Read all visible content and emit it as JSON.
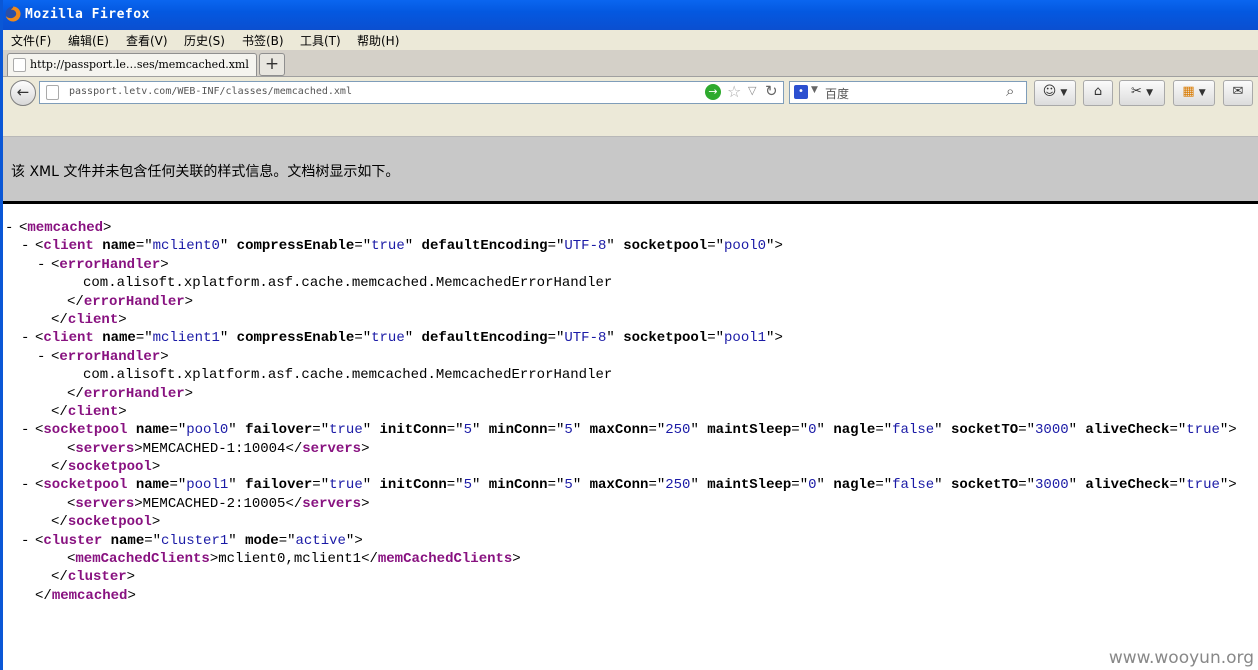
{
  "window": {
    "title": "Mozilla Firefox"
  },
  "menu": [
    "文件(F)",
    "编辑(E)",
    "查看(V)",
    "历史(S)",
    "书签(B)",
    "工具(T)",
    "帮助(H)"
  ],
  "tab": {
    "label": "http://passport.le…ses/memcached.xml",
    "new_tab": "+"
  },
  "nav": {
    "url": "passport.letv.com/WEB-INF/classes/memcached.xml",
    "search_placeholder": "百度"
  },
  "banner": "该 XML 文件并未包含任何关联的样式信息。文档树显示如下。",
  "xml": [
    {
      "ctl": "-",
      "indent": 0,
      "parts": [
        {
          "t": "b",
          "v": "<"
        },
        {
          "t": "tag",
          "v": "memcached"
        },
        {
          "t": "b",
          "v": ">"
        }
      ]
    },
    {
      "ctl": "-",
      "indent": 1,
      "parts": [
        {
          "t": "b",
          "v": "<"
        },
        {
          "t": "tag",
          "v": "client"
        },
        {
          "t": "an",
          "v": " name"
        },
        {
          "t": "b",
          "v": "=\""
        },
        {
          "t": "av",
          "v": "mclient0"
        },
        {
          "t": "b",
          "v": "\""
        },
        {
          "t": "an",
          "v": " compressEnable"
        },
        {
          "t": "b",
          "v": "=\""
        },
        {
          "t": "av",
          "v": "true"
        },
        {
          "t": "b",
          "v": "\""
        },
        {
          "t": "an",
          "v": " defaultEncoding"
        },
        {
          "t": "b",
          "v": "=\""
        },
        {
          "t": "av",
          "v": "UTF-8"
        },
        {
          "t": "b",
          "v": "\""
        },
        {
          "t": "an",
          "v": " socketpool"
        },
        {
          "t": "b",
          "v": "=\""
        },
        {
          "t": "av",
          "v": "pool0"
        },
        {
          "t": "b",
          "v": "\">"
        }
      ]
    },
    {
      "ctl": "-",
      "indent": 2,
      "parts": [
        {
          "t": "b",
          "v": "<"
        },
        {
          "t": "tag",
          "v": "errorHandler"
        },
        {
          "t": "b",
          "v": ">"
        }
      ]
    },
    {
      "ctl": "",
      "indent": 4,
      "parts": [
        {
          "t": "tx",
          "v": "com.alisoft.xplatform.asf.cache.memcached.MemcachedErrorHandler"
        }
      ]
    },
    {
      "ctl": "",
      "indent": 3,
      "parts": [
        {
          "t": "b",
          "v": "</"
        },
        {
          "t": "tag",
          "v": "errorHandler"
        },
        {
          "t": "b",
          "v": ">"
        }
      ]
    },
    {
      "ctl": "",
      "indent": 2,
      "parts": [
        {
          "t": "b",
          "v": "</"
        },
        {
          "t": "tag",
          "v": "client"
        },
        {
          "t": "b",
          "v": ">"
        }
      ]
    },
    {
      "ctl": "-",
      "indent": 1,
      "parts": [
        {
          "t": "b",
          "v": "<"
        },
        {
          "t": "tag",
          "v": "client"
        },
        {
          "t": "an",
          "v": " name"
        },
        {
          "t": "b",
          "v": "=\""
        },
        {
          "t": "av",
          "v": "mclient1"
        },
        {
          "t": "b",
          "v": "\""
        },
        {
          "t": "an",
          "v": " compressEnable"
        },
        {
          "t": "b",
          "v": "=\""
        },
        {
          "t": "av",
          "v": "true"
        },
        {
          "t": "b",
          "v": "\""
        },
        {
          "t": "an",
          "v": " defaultEncoding"
        },
        {
          "t": "b",
          "v": "=\""
        },
        {
          "t": "av",
          "v": "UTF-8"
        },
        {
          "t": "b",
          "v": "\""
        },
        {
          "t": "an",
          "v": " socketpool"
        },
        {
          "t": "b",
          "v": "=\""
        },
        {
          "t": "av",
          "v": "pool1"
        },
        {
          "t": "b",
          "v": "\">"
        }
      ]
    },
    {
      "ctl": "-",
      "indent": 2,
      "parts": [
        {
          "t": "b",
          "v": "<"
        },
        {
          "t": "tag",
          "v": "errorHandler"
        },
        {
          "t": "b",
          "v": ">"
        }
      ]
    },
    {
      "ctl": "",
      "indent": 4,
      "parts": [
        {
          "t": "tx",
          "v": "com.alisoft.xplatform.asf.cache.memcached.MemcachedErrorHandler"
        }
      ]
    },
    {
      "ctl": "",
      "indent": 3,
      "parts": [
        {
          "t": "b",
          "v": "</"
        },
        {
          "t": "tag",
          "v": "errorHandler"
        },
        {
          "t": "b",
          "v": ">"
        }
      ]
    },
    {
      "ctl": "",
      "indent": 2,
      "parts": [
        {
          "t": "b",
          "v": "</"
        },
        {
          "t": "tag",
          "v": "client"
        },
        {
          "t": "b",
          "v": ">"
        }
      ]
    },
    {
      "ctl": "-",
      "indent": 1,
      "parts": [
        {
          "t": "b",
          "v": "<"
        },
        {
          "t": "tag",
          "v": "socketpool"
        },
        {
          "t": "an",
          "v": " name"
        },
        {
          "t": "b",
          "v": "=\""
        },
        {
          "t": "av",
          "v": "pool0"
        },
        {
          "t": "b",
          "v": "\""
        },
        {
          "t": "an",
          "v": " failover"
        },
        {
          "t": "b",
          "v": "=\""
        },
        {
          "t": "av",
          "v": "true"
        },
        {
          "t": "b",
          "v": "\""
        },
        {
          "t": "an",
          "v": " initConn"
        },
        {
          "t": "b",
          "v": "=\""
        },
        {
          "t": "av",
          "v": "5"
        },
        {
          "t": "b",
          "v": "\""
        },
        {
          "t": "an",
          "v": " minConn"
        },
        {
          "t": "b",
          "v": "=\""
        },
        {
          "t": "av",
          "v": "5"
        },
        {
          "t": "b",
          "v": "\""
        },
        {
          "t": "an",
          "v": " maxConn"
        },
        {
          "t": "b",
          "v": "=\""
        },
        {
          "t": "av",
          "v": "250"
        },
        {
          "t": "b",
          "v": "\""
        },
        {
          "t": "an",
          "v": " maintSleep"
        },
        {
          "t": "b",
          "v": "=\""
        },
        {
          "t": "av",
          "v": "0"
        },
        {
          "t": "b",
          "v": "\""
        },
        {
          "t": "an",
          "v": " nagle"
        },
        {
          "t": "b",
          "v": "=\""
        },
        {
          "t": "av",
          "v": "false"
        },
        {
          "t": "b",
          "v": "\""
        },
        {
          "t": "an",
          "v": " socketTO"
        },
        {
          "t": "b",
          "v": "=\""
        },
        {
          "t": "av",
          "v": "3000"
        },
        {
          "t": "b",
          "v": "\""
        },
        {
          "t": "an",
          "v": " aliveCheck"
        },
        {
          "t": "b",
          "v": "=\""
        },
        {
          "t": "av",
          "v": "true"
        },
        {
          "t": "b",
          "v": "\">"
        }
      ]
    },
    {
      "ctl": "",
      "indent": 3,
      "parts": [
        {
          "t": "b",
          "v": "<"
        },
        {
          "t": "tag",
          "v": "servers"
        },
        {
          "t": "b",
          "v": ">"
        },
        {
          "t": "tx",
          "v": "MEMCACHED-1:10004"
        },
        {
          "t": "b",
          "v": "</"
        },
        {
          "t": "tag",
          "v": "servers"
        },
        {
          "t": "b",
          "v": ">"
        }
      ]
    },
    {
      "ctl": "",
      "indent": 2,
      "parts": [
        {
          "t": "b",
          "v": "</"
        },
        {
          "t": "tag",
          "v": "socketpool"
        },
        {
          "t": "b",
          "v": ">"
        }
      ]
    },
    {
      "ctl": "-",
      "indent": 1,
      "parts": [
        {
          "t": "b",
          "v": "<"
        },
        {
          "t": "tag",
          "v": "socketpool"
        },
        {
          "t": "an",
          "v": " name"
        },
        {
          "t": "b",
          "v": "=\""
        },
        {
          "t": "av",
          "v": "pool1"
        },
        {
          "t": "b",
          "v": "\""
        },
        {
          "t": "an",
          "v": " failover"
        },
        {
          "t": "b",
          "v": "=\""
        },
        {
          "t": "av",
          "v": "true"
        },
        {
          "t": "b",
          "v": "\""
        },
        {
          "t": "an",
          "v": " initConn"
        },
        {
          "t": "b",
          "v": "=\""
        },
        {
          "t": "av",
          "v": "5"
        },
        {
          "t": "b",
          "v": "\""
        },
        {
          "t": "an",
          "v": " minConn"
        },
        {
          "t": "b",
          "v": "=\""
        },
        {
          "t": "av",
          "v": "5"
        },
        {
          "t": "b",
          "v": "\""
        },
        {
          "t": "an",
          "v": " maxConn"
        },
        {
          "t": "b",
          "v": "=\""
        },
        {
          "t": "av",
          "v": "250"
        },
        {
          "t": "b",
          "v": "\""
        },
        {
          "t": "an",
          "v": " maintSleep"
        },
        {
          "t": "b",
          "v": "=\""
        },
        {
          "t": "av",
          "v": "0"
        },
        {
          "t": "b",
          "v": "\""
        },
        {
          "t": "an",
          "v": " nagle"
        },
        {
          "t": "b",
          "v": "=\""
        },
        {
          "t": "av",
          "v": "false"
        },
        {
          "t": "b",
          "v": "\""
        },
        {
          "t": "an",
          "v": " socketTO"
        },
        {
          "t": "b",
          "v": "=\""
        },
        {
          "t": "av",
          "v": "3000"
        },
        {
          "t": "b",
          "v": "\""
        },
        {
          "t": "an",
          "v": " aliveCheck"
        },
        {
          "t": "b",
          "v": "=\""
        },
        {
          "t": "av",
          "v": "true"
        },
        {
          "t": "b",
          "v": "\">"
        }
      ]
    },
    {
      "ctl": "",
      "indent": 3,
      "parts": [
        {
          "t": "b",
          "v": "<"
        },
        {
          "t": "tag",
          "v": "servers"
        },
        {
          "t": "b",
          "v": ">"
        },
        {
          "t": "tx",
          "v": "MEMCACHED-2:10005"
        },
        {
          "t": "b",
          "v": "</"
        },
        {
          "t": "tag",
          "v": "servers"
        },
        {
          "t": "b",
          "v": ">"
        }
      ]
    },
    {
      "ctl": "",
      "indent": 2,
      "parts": [
        {
          "t": "b",
          "v": "</"
        },
        {
          "t": "tag",
          "v": "socketpool"
        },
        {
          "t": "b",
          "v": ">"
        }
      ]
    },
    {
      "ctl": "-",
      "indent": 1,
      "parts": [
        {
          "t": "b",
          "v": "<"
        },
        {
          "t": "tag",
          "v": "cluster"
        },
        {
          "t": "an",
          "v": " name"
        },
        {
          "t": "b",
          "v": "=\""
        },
        {
          "t": "av",
          "v": "cluster1"
        },
        {
          "t": "b",
          "v": "\""
        },
        {
          "t": "an",
          "v": " mode"
        },
        {
          "t": "b",
          "v": "=\""
        },
        {
          "t": "av",
          "v": "active"
        },
        {
          "t": "b",
          "v": "\">"
        }
      ]
    },
    {
      "ctl": "",
      "indent": 3,
      "parts": [
        {
          "t": "b",
          "v": "<"
        },
        {
          "t": "tag",
          "v": "memCachedClients"
        },
        {
          "t": "b",
          "v": ">"
        },
        {
          "t": "tx",
          "v": "mclient0,mclient1"
        },
        {
          "t": "b",
          "v": "</"
        },
        {
          "t": "tag",
          "v": "memCachedClients"
        },
        {
          "t": "b",
          "v": ">"
        }
      ]
    },
    {
      "ctl": "",
      "indent": 2,
      "parts": [
        {
          "t": "b",
          "v": "</"
        },
        {
          "t": "tag",
          "v": "cluster"
        },
        {
          "t": "b",
          "v": ">"
        }
      ]
    },
    {
      "ctl": "",
      "indent": 1,
      "parts": [
        {
          "t": "b",
          "v": "</"
        },
        {
          "t": "tag",
          "v": "memcached"
        },
        {
          "t": "b",
          "v": ">"
        }
      ]
    }
  ],
  "watermark": "www.wooyun.org"
}
